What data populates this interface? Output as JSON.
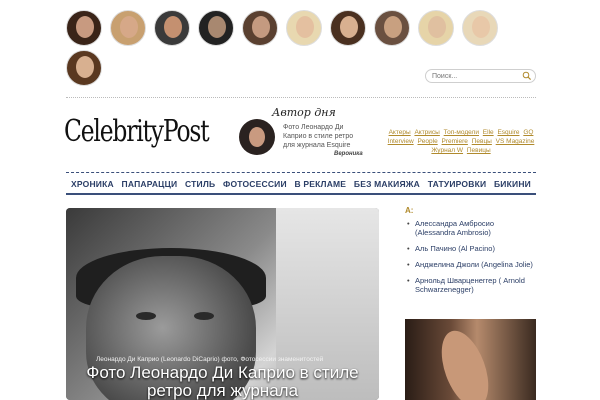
{
  "avatars": [
    {
      "name": "celebrity-1",
      "skin": "#c89a80",
      "hair": "#3a2418"
    },
    {
      "name": "celebrity-2",
      "skin": "#d6a888",
      "hair": "#c8a070"
    },
    {
      "name": "celebrity-3",
      "skin": "#c49070",
      "hair": "#3a3a3a"
    },
    {
      "name": "celebrity-4",
      "skin": "#a88870",
      "hair": "#222222"
    },
    {
      "name": "celebrity-5",
      "skin": "#c49a80",
      "hair": "#5a4030"
    },
    {
      "name": "celebrity-6",
      "skin": "#e4c0a0",
      "hair": "#e8d8b0"
    },
    {
      "name": "celebrity-7",
      "skin": "#d8b090",
      "hair": "#4a3020"
    },
    {
      "name": "celebrity-8",
      "skin": "#c8a080",
      "hair": "#6a5040"
    },
    {
      "name": "celebrity-9",
      "skin": "#e0c0a0",
      "hair": "#e6d4a8"
    },
    {
      "name": "celebrity-10",
      "skin": "#e8c8a8",
      "hair": "#e8d8b8"
    },
    {
      "name": "celebrity-11",
      "skin": "#d8b090",
      "hair": "#5a3820"
    }
  ],
  "search": {
    "placeholder": "Поиск..."
  },
  "logo": "CelebrityPost",
  "author_of_day": {
    "title": "Автор дня",
    "text": "Фото Леонардо Ди Каприо в стиле ретро для журнала Esquire",
    "name": "Вероника"
  },
  "tags": [
    "Актеры",
    "Актрисы",
    "Топ-модели",
    "Elle",
    "Esquire",
    "GQ",
    "Interview",
    "People",
    "Premiere",
    "Певцы",
    "VS Magazine",
    "Журнал W",
    "Певицы"
  ],
  "nav": [
    "ХРОНИКА",
    "ПАПАРАЦЦИ",
    "СТИЛЬ",
    "ФОТОСЕССИИ",
    "В РЕКЛАМЕ",
    "БЕЗ МАКИЯЖА",
    "ТАТУИРОВКИ",
    "БИКИНИ"
  ],
  "hero": {
    "caption_small": "Леонардо Ди Каприо (Leonardo DiCaprio) фото, Фотосессии знаменитостей",
    "caption_big": "Фото Леонардо Ди Каприо в стиле ретро для журнала"
  },
  "sidebar": {
    "letter": "А:",
    "items": [
      "Алессандра Амбросио (Alessandra Ambrosio)",
      "Аль Пачино (Al Pacino)",
      "Анджелина Джоли (Angelina Jolie)",
      "Арнольд Шварценеггер ( Arnold Schwarzenegger)"
    ]
  },
  "colors": {
    "nav": "#2b3e66",
    "accent": "#b08a2c"
  }
}
